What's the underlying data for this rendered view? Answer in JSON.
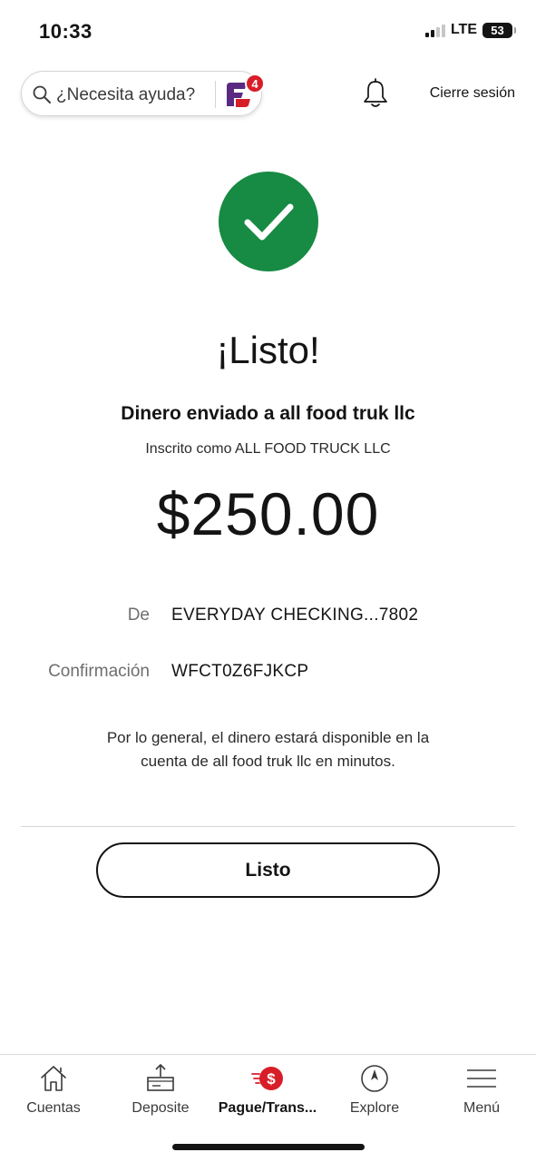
{
  "status_bar": {
    "time": "10:33",
    "network": "LTE",
    "battery": "53"
  },
  "header": {
    "search_placeholder": "¿Necesita ayuda?",
    "assistant_badge_count": "4",
    "signout_label": "Cierre sesión",
    "icons": [
      "search-icon",
      "fargo-assistant-icon",
      "bell-icon"
    ]
  },
  "confirmation": {
    "heading": "¡Listo!",
    "sent_to": "Dinero enviado a all food truk llc",
    "enrolled_as": "Inscrito como ALL FOOD TRUCK LLC",
    "amount": "$250.00",
    "from_label": "De",
    "from_value": "EVERYDAY CHECKING...7802",
    "confirmation_label": "Confirmación",
    "confirmation_value": "WFCT0Z6FJKCP",
    "note_line1": "Por lo general, el dinero estará disponible en la",
    "note_line2": "cuenta de all food truk llc en minutos.",
    "done_button": "Listo"
  },
  "bottom_nav": {
    "items": [
      {
        "label": "Cuentas",
        "icon": "home-icon"
      },
      {
        "label": "Deposite",
        "icon": "deposit-icon"
      },
      {
        "label": "Pague/Trans...",
        "icon": "pay-transfer-icon",
        "active": true
      },
      {
        "label": "Explore",
        "icon": "compass-icon"
      },
      {
        "label": "Menú",
        "icon": "menu-icon"
      }
    ]
  },
  "colors": {
    "success_green": "#178a43",
    "brand_red": "#d71e28",
    "assistant_purple": "#5a2a82"
  }
}
